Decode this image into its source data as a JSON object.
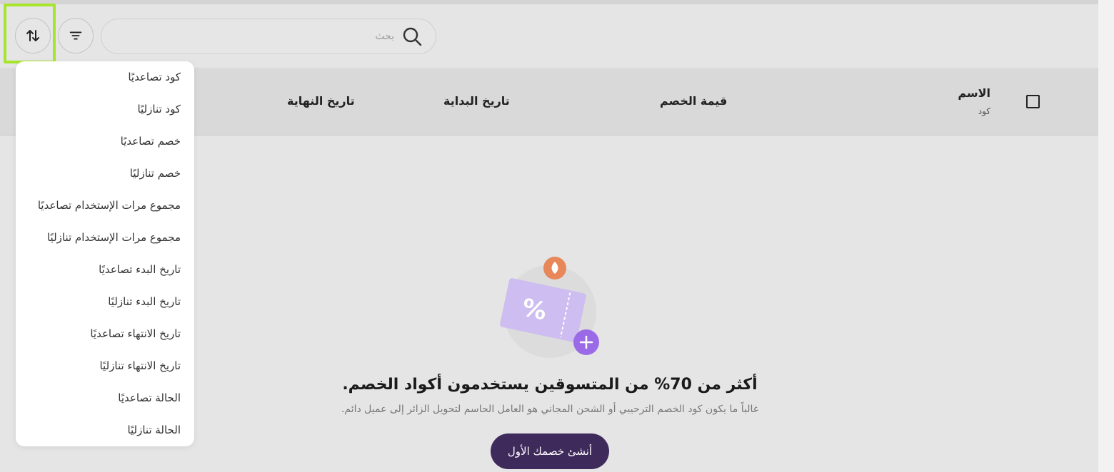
{
  "toolbar": {
    "sort_icon": "sort-arrows-icon",
    "filter_icon": "filter-lines-icon",
    "search_placeholder": "بحث",
    "search_value": ""
  },
  "table": {
    "columns": {
      "name": "الاسم",
      "code": "كود",
      "discount_value": "قيمة الخصم",
      "start_date": "تاريخ البداية",
      "end_date": "تاريخ النهاية"
    }
  },
  "sort_menu": {
    "items": [
      "كود تصاعديًا",
      "كود تنازليًا",
      "خصم تصاعديًا",
      "خصم تنازليًا",
      "مجموع مرات الإستخدام تصاعديًا",
      "مجموع مرات الإستخدام تنازليًا",
      "تاريخ البدء تصاعديًا",
      "تاريخ البدء تنازليًا",
      "تاريخ الانتهاء تصاعديًا",
      "تاريخ الانتهاء تنازليًا",
      "الحالة تصاعديًا",
      "الحالة تنازليًا"
    ]
  },
  "empty_state": {
    "illustration": "discount-coupon-illustration",
    "title": "أكثر من 70% من المتسوقين يستخدمون أكواد الخصم.",
    "description": "غالباً ما يكون كود الخصم الترحيبي أو الشحن المجاني هو العامل الحاسم لتحويل الزائر إلى عميل دائم.",
    "cta_label": "أنشئ خصمك الأول"
  },
  "colors": {
    "highlight": "#a7e52a",
    "cta_bg": "#3f2a5c",
    "coupon": "#cdbdf0",
    "plus_badge": "#9b6ae6",
    "flame_badge": "#e8875a"
  }
}
